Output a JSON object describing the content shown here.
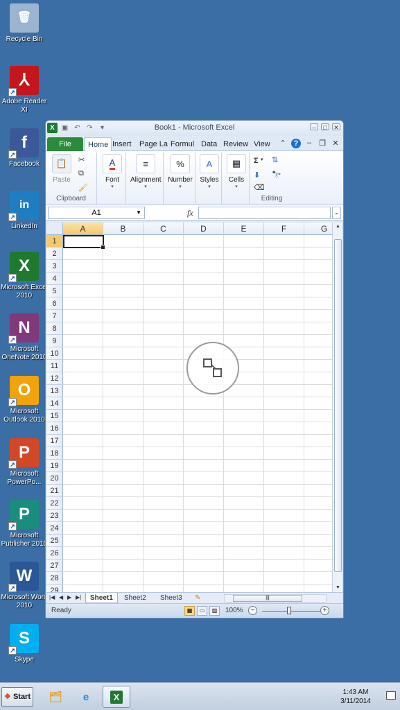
{
  "desktop_icons": [
    {
      "label": "Recycle Bin",
      "icon": "recycle-bin-icon",
      "color": "#9bb4cf"
    },
    {
      "label": "Adobe Reader XI",
      "icon": "adobe-reader-icon",
      "color": "#c4161c"
    },
    {
      "label": "Facebook",
      "icon": "facebook-icon",
      "color": "#3b5998"
    },
    {
      "label": "LinkedIn",
      "icon": "linkedin-icon",
      "color": "#1f7ec1"
    },
    {
      "label": "Microsoft Excel 2010",
      "icon": "excel-icon",
      "color": "#1f7a2f"
    },
    {
      "label": "Microsoft OneNote 2010",
      "icon": "onenote-icon",
      "color": "#80397b"
    },
    {
      "label": "Microsoft Outlook 2010",
      "icon": "outlook-icon",
      "color": "#f0a30a"
    },
    {
      "label": "Microsoft PowerPo...",
      "icon": "powerpoint-icon",
      "color": "#d24726"
    },
    {
      "label": "Microsoft Publisher 2010",
      "icon": "publisher-icon",
      "color": "#1a8d7f"
    },
    {
      "label": "Microsoft Word 2010",
      "icon": "word-icon",
      "color": "#2b5797"
    },
    {
      "label": "Skype",
      "icon": "skype-icon",
      "color": "#00aff0"
    }
  ],
  "window": {
    "title": "Book1 - Microsoft Excel",
    "tabs": [
      "File",
      "Home",
      "Insert",
      "Page La",
      "Formul",
      "Data",
      "Review",
      "View"
    ],
    "ribbon": {
      "paste": "Paste",
      "clipboard": "Clipboard",
      "font": "Font",
      "alignment": "Alignment",
      "number": "Number",
      "number_symbol": "%",
      "styles": "Styles",
      "cells": "Cells",
      "editing": "Editing",
      "sum_symbol": "Σ"
    },
    "name_box": "A1",
    "fx": "fx",
    "columns": [
      "A",
      "B",
      "C",
      "D",
      "E",
      "F",
      "G"
    ],
    "rows": [
      "1",
      "2",
      "3",
      "4",
      "5",
      "6",
      "7",
      "8",
      "9",
      "10",
      "11",
      "12",
      "13",
      "14",
      "15",
      "16",
      "17",
      "18",
      "19",
      "20",
      "21",
      "22",
      "23",
      "24",
      "25",
      "26",
      "27",
      "28",
      "29"
    ],
    "sheets": [
      "Sheet1",
      "Sheet2",
      "Sheet3"
    ],
    "status": "Ready",
    "zoom": "100%"
  },
  "taskbar": {
    "start": "Start",
    "time": "1:43 AM",
    "date": "3/11/2014"
  }
}
